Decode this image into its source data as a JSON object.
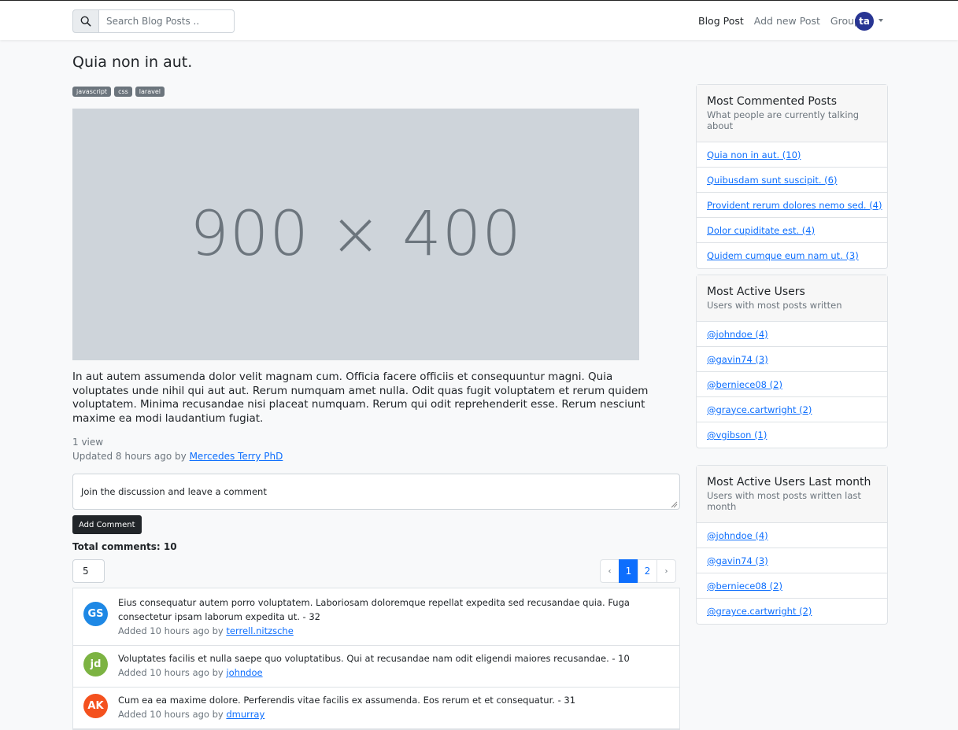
{
  "nav": {
    "search_placeholder": "Search Blog Posts ..",
    "links": [
      "Blog Post",
      "Add new Post",
      "Groups"
    ],
    "user_initials": "ta"
  },
  "post": {
    "title": "Quia non in aut.",
    "tags": [
      "javascript",
      "css",
      "laravel"
    ],
    "image_text": "900 × 400",
    "body": "In aut autem assumenda dolor velit magnam cum. Officia facere officiis et consequuntur magni. Quia voluptates unde nihil qui aut aut. Rerum numquam amet nulla. Odit quas fugit voluptatem et rerum quidem voluptatem. Minima recusandae nisi placeat numquam. Rerum qui odit reprehenderit esse. Rerum nesciunt maxime ea modi laudantium fugiat.",
    "views": "1 view",
    "updated_prefix": "Updated 8 hours ago by",
    "author": "Mercedes Terry PhD"
  },
  "comment_form": {
    "placeholder": "Join the discussion and leave a comment",
    "button_label": "Add Comment"
  },
  "comments_meta": {
    "total_label": "Total comments:",
    "total_value": "10",
    "per_page": "5",
    "pagination": [
      "‹",
      "1",
      "2",
      "›"
    ],
    "active_page": "1"
  },
  "comments": [
    {
      "initials": "GS",
      "color": "#1e88e5",
      "text": "Eius consequatur autem porro voluptatem. Laboriosam doloremque repellat expedita sed recusandae quia. Fuga consectetur ipsam laborum expedita ut. - 32",
      "meta": "Added 10 hours ago by",
      "user": "terrell.nitzsche"
    },
    {
      "initials": "jd",
      "color": "#7cb342",
      "text": "Voluptates facilis et nulla saepe quo voluptatibus. Qui at recusandae nam odit eligendi maiores recusandae. - 10",
      "meta": "Added 10 hours ago by",
      "user": "johndoe"
    },
    {
      "initials": "AK",
      "color": "#f4511e",
      "text": "Cum ea ea maxime dolore. Perferendis vitae facilis ex assumenda. Eos rerum et et consequatur. - 31",
      "meta": "Added 10 hours ago by",
      "user": "dmurray"
    }
  ],
  "sidebar": {
    "most_commented": {
      "title": "Most Commented Posts",
      "subtitle": "What people are currently talking about",
      "items": [
        "Quia non in aut. (10)",
        "Quibusdam sunt suscipit. (6)",
        "Provident rerum dolores nemo sed. (4)",
        "Dolor cupiditate est. (4)",
        "Quidem cumque eum nam ut. (3)"
      ]
    },
    "most_active": {
      "title": "Most Active Users",
      "subtitle": "Users with most posts written",
      "items": [
        "@johndoe (4)",
        "@gavin74 (3)",
        "@berniece08 (2)",
        "@grayce.cartwright (2)",
        "@vgibson (1)"
      ]
    },
    "most_active_month": {
      "title": "Most Active Users Last month",
      "subtitle": "Users with most posts written last month",
      "items": [
        "@johndoe (4)",
        "@gavin74 (3)",
        "@berniece08 (2)",
        "@grayce.cartwright (2)"
      ]
    }
  }
}
